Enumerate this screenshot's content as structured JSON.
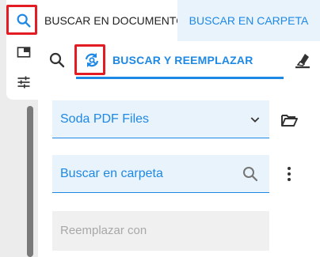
{
  "tabs": {
    "document_label": "BUSCAR EN DOCUMENTO",
    "folder_label": "BUSCAR EN CARPETA"
  },
  "subbar": {
    "label": "BUSCAR Y REEMPLAZAR"
  },
  "fields": {
    "folder_value": "Soda PDF Files",
    "search_placeholder": "Buscar en carpeta",
    "replace_placeholder": "Reemplazar con"
  },
  "icons": {
    "rail": [
      "search-icon",
      "panel-icon",
      "filter-settings-icon"
    ],
    "subbar": [
      "search-icon",
      "search-replace-icon",
      "eraser-icon"
    ],
    "fields": [
      "chevron-down-icon",
      "folder-open-icon",
      "search-icon",
      "more-vertical-icon"
    ]
  },
  "colors": {
    "accent": "#1e88e5",
    "highlight": "#e31b23",
    "field_bg": "#e9f3fb"
  }
}
